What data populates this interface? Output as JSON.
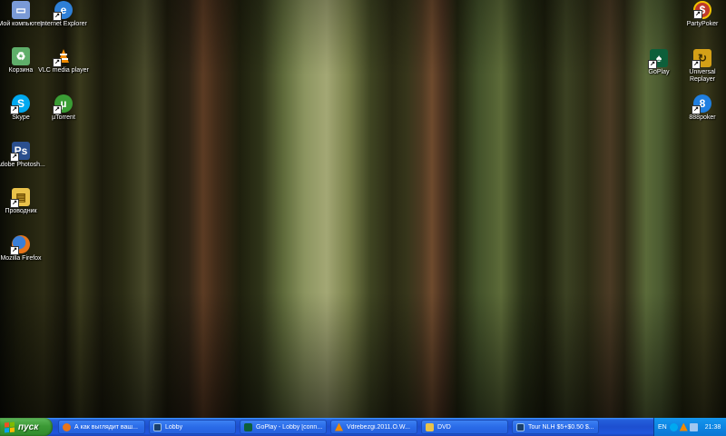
{
  "desktop_icons": [
    {
      "label": "Мой компьютер",
      "icon": "my-computer-icon",
      "color": "#7a9ad6",
      "shortcut": false
    },
    {
      "label": "Корзина",
      "icon": "recycle-bin-icon",
      "color": "#5fae6a",
      "shortcut": false
    },
    {
      "label": "Skype",
      "icon": "skype-icon",
      "color": "#00a9f0",
      "shortcut": true
    },
    {
      "label": "Adobe Photosh...",
      "icon": "photoshop-icon",
      "color": "#2a4f8e",
      "shortcut": true
    },
    {
      "label": "Проводник",
      "icon": "explorer-icon",
      "color": "#e9c24a",
      "shortcut": true
    },
    {
      "label": "Mozilla Firefox",
      "icon": "firefox-icon",
      "color": "#e8751a",
      "shortcut": true
    },
    {
      "label": "Internet Explorer",
      "icon": "internet-explorer-icon",
      "color": "#2e7fd6",
      "shortcut": true
    },
    {
      "label": "VLC media player",
      "icon": "vlc-icon",
      "color": "#f08a00",
      "shortcut": true
    },
    {
      "label": "µTorrent",
      "icon": "utorrent-icon",
      "color": "#3a9d35",
      "shortcut": true
    },
    {
      "label": "PartyPoker",
      "icon": "partypoker-icon",
      "color": "#c0392b",
      "shortcut": true
    },
    {
      "label": "GoPlay",
      "icon": "goplay-icon",
      "color": "#0d5f3a",
      "shortcut": true
    },
    {
      "label": "Universal Replayer",
      "icon": "universal-replayer-icon",
      "color": "#d4a017",
      "shortcut": true
    },
    {
      "label": "888poker",
      "icon": "888poker-icon",
      "color": "#1f7fe0",
      "shortcut": true
    }
  ],
  "taskbar": {
    "start_label": "пуск",
    "tasks": [
      {
        "label": "А как выглядит ваш...",
        "icon": "firefox-icon",
        "color": "#e8751a"
      },
      {
        "label": "Lobby",
        "icon": "lobby-icon",
        "color": "#1a3f6b"
      },
      {
        "label": "GoPlay - Lobby [conn...",
        "icon": "goplay-icon",
        "color": "#0d5f3a"
      },
      {
        "label": "Vdrebezgi.2011.O.W...",
        "icon": "vlc-icon",
        "color": "#f08a00"
      },
      {
        "label": "DVD",
        "icon": "folder-icon",
        "color": "#e9c24a"
      },
      {
        "label": "Tour NLH $5+$0.50 $...",
        "icon": "lobby-icon",
        "color": "#1a3f6b"
      }
    ],
    "tray": {
      "language": "EN",
      "clock": "21:38",
      "icons": [
        {
          "icon": "skype-tray-icon",
          "color": "#00a9f0"
        },
        {
          "icon": "vlc-tray-icon",
          "color": "#f08a00"
        },
        {
          "icon": "network-tray-icon",
          "color": "#9fc7f0"
        }
      ]
    }
  }
}
